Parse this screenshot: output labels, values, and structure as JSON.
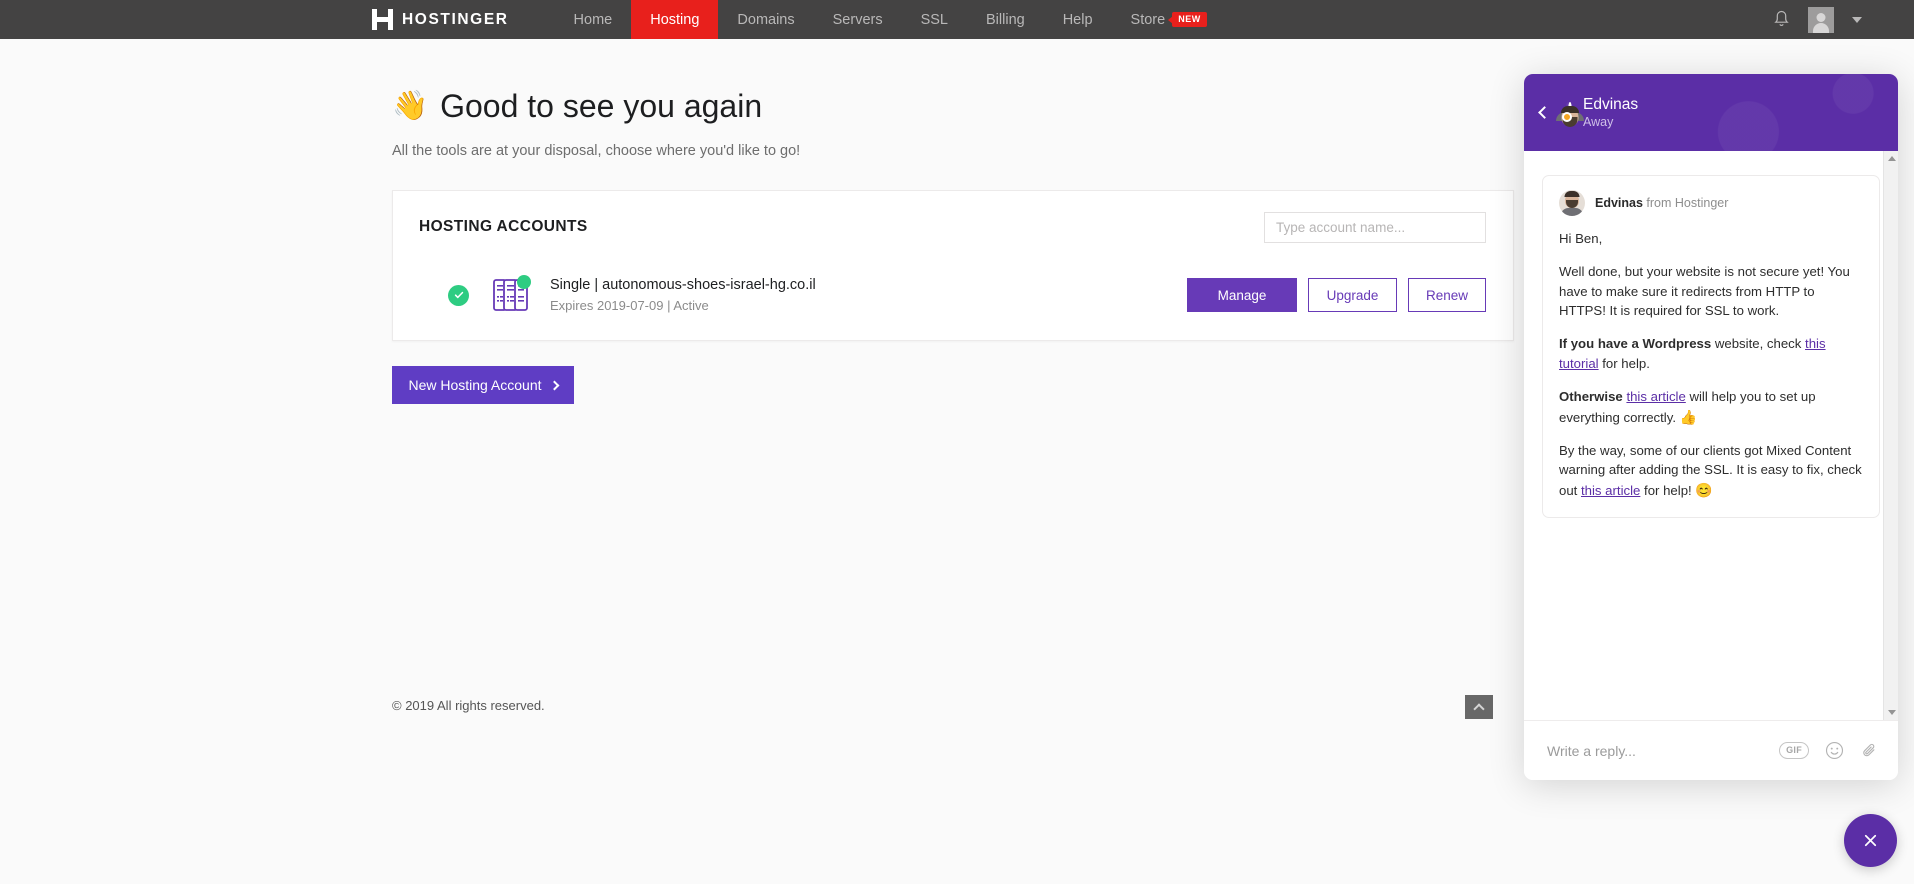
{
  "nav": {
    "brand": "HOSTINGER",
    "items": [
      {
        "label": "Home",
        "active": false
      },
      {
        "label": "Hosting",
        "active": true
      },
      {
        "label": "Domains",
        "active": false
      },
      {
        "label": "Servers",
        "active": false
      },
      {
        "label": "SSL",
        "active": false
      },
      {
        "label": "Billing",
        "active": false
      },
      {
        "label": "Help",
        "active": false
      }
    ],
    "store_label": "Store",
    "store_badge": "NEW",
    "notifications_icon": "bell-icon",
    "avatar_icon": "user-avatar-icon",
    "caret_icon": "chevron-down-icon"
  },
  "page": {
    "greeting_emoji": "👋",
    "greeting": "Good to see you again",
    "subtitle": "All the tools are at your disposal, choose where you'd like to go!"
  },
  "card": {
    "title": "HOSTING ACCOUNTS",
    "search_placeholder": "Type account name...",
    "search_value": "",
    "account": {
      "status_icon": "check-circle-icon",
      "plan_icon": "hosting-plan-icon",
      "name": "Single | autonomous-shoes-israel-hg.co.il",
      "meta": "Expires 2019-07-09 | Active",
      "expires": "2019-07-09",
      "status": "Active",
      "actions": {
        "manage": "Manage",
        "upgrade": "Upgrade",
        "renew": "Renew"
      }
    }
  },
  "new_account_button": "New Hosting Account",
  "footer": "© 2019 All rights reserved.",
  "scroll_top_icon": "chevron-up-icon",
  "chat": {
    "back_icon": "chevron-left-icon",
    "agent_name": "Edvinas",
    "agent_status": "Away",
    "message": {
      "sender_name": "Edvinas",
      "sender_suffix": "from Hostinger",
      "p1": "Hi Ben,",
      "p2": "Well done, but your website is not secure yet! You have to make sure it redirects from HTTP to HTTPS! It is required for SSL to work.",
      "p3_bold": "If you have a Wordpress",
      "p3_mid": " website, check ",
      "p3_link": "this tutorial",
      "p3_end": " for help.",
      "p4_bold": "Otherwise",
      "p4_link": "this article",
      "p4_end": " will help you to set up everything correctly.",
      "p4_emoji": "👍",
      "p5_start": "By the way, some of our clients got Mixed Content warning after adding the SSL. It is easy to fix, check out ",
      "p5_link": "this article",
      "p5_end": " for help!",
      "p5_emoji": "😊"
    },
    "reply_placeholder": "Write a reply...",
    "reply_value": "",
    "gif_label": "GIF",
    "emoji_icon": "smiley-icon",
    "attach_icon": "paperclip-icon",
    "close_icon": "close-icon"
  },
  "colors": {
    "nav_bg": "#444343",
    "accent_red": "#e8201c",
    "purple": "#5b2ea6",
    "button_purple": "#673ab7",
    "green": "#2ecc82",
    "status_orange": "#f5a623"
  }
}
